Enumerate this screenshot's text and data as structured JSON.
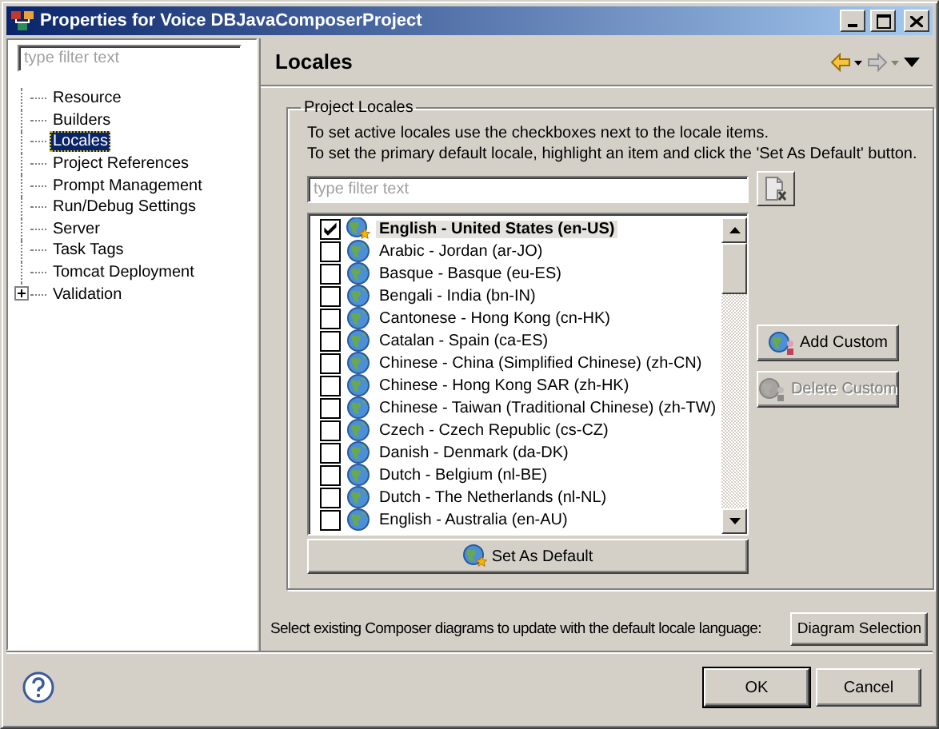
{
  "window": {
    "title": "Properties for Voice DBJavaComposerProject"
  },
  "sidebar": {
    "filter": {
      "placeholder": "type filter text"
    },
    "items": [
      {
        "label": "Resource",
        "selected": false
      },
      {
        "label": "Builders",
        "selected": false
      },
      {
        "label": "Locales",
        "selected": true
      },
      {
        "label": "Project References",
        "selected": false
      },
      {
        "label": "Prompt Management",
        "selected": false
      },
      {
        "label": "Run/Debug Settings",
        "selected": false
      },
      {
        "label": "Server",
        "selected": false
      },
      {
        "label": "Task Tags",
        "selected": false
      },
      {
        "label": "Tomcat Deployment",
        "selected": false
      },
      {
        "label": "Validation",
        "selected": false,
        "expanded": false
      }
    ]
  },
  "page": {
    "title": "Locales"
  },
  "group": {
    "title": "Project Locales",
    "instructions": [
      "To set active locales use the checkboxes next to the locale items.",
      "To set the primary default locale, highlight an item and click the 'Set As Default' button."
    ],
    "filter": {
      "placeholder": "type filter text"
    },
    "locales": [
      {
        "label": "English - United States (en-US)",
        "checked": true,
        "default": true,
        "selected": true
      },
      {
        "label": "Arabic - Jordan (ar-JO)",
        "checked": false,
        "default": false,
        "selected": false
      },
      {
        "label": "Basque - Basque (eu-ES)",
        "checked": false,
        "default": false,
        "selected": false
      },
      {
        "label": "Bengali - India (bn-IN)",
        "checked": false,
        "default": false,
        "selected": false
      },
      {
        "label": "Cantonese - Hong Kong (cn-HK)",
        "checked": false,
        "default": false,
        "selected": false
      },
      {
        "label": "Catalan - Spain (ca-ES)",
        "checked": false,
        "default": false,
        "selected": false
      },
      {
        "label": "Chinese - China (Simplified Chinese) (zh-CN)",
        "checked": false,
        "default": false,
        "selected": false
      },
      {
        "label": "Chinese - Hong Kong SAR (zh-HK)",
        "checked": false,
        "default": false,
        "selected": false
      },
      {
        "label": "Chinese - Taiwan (Traditional Chinese) (zh-TW)",
        "checked": false,
        "default": false,
        "selected": false
      },
      {
        "label": "Czech - Czech Republic (cs-CZ)",
        "checked": false,
        "default": false,
        "selected": false
      },
      {
        "label": "Danish - Denmark (da-DK)",
        "checked": false,
        "default": false,
        "selected": false
      },
      {
        "label": "Dutch - Belgium (nl-BE)",
        "checked": false,
        "default": false,
        "selected": false
      },
      {
        "label": "Dutch - The Netherlands (nl-NL)",
        "checked": false,
        "default": false,
        "selected": false
      },
      {
        "label": "English - Australia (en-AU)",
        "checked": false,
        "default": false,
        "selected": false
      }
    ],
    "side_buttons": [
      {
        "label": "Add Custom",
        "disabled": false
      },
      {
        "label": "Delete Custom",
        "disabled": true
      }
    ],
    "set_default_button": "Set As Default"
  },
  "diagram_note": "Select existing Composer diagrams to update with the default locale language:",
  "diagram_button": "Diagram Selection",
  "buttons": [
    "OK",
    "Cancel"
  ]
}
